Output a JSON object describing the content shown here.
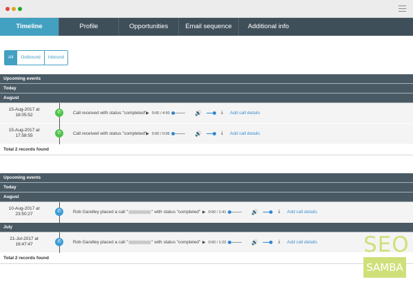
{
  "tabs": [
    "Timeline",
    "Profile",
    "Opportunities",
    "Email sequence",
    "Additional info"
  ],
  "filters": [
    "All",
    "Outbound",
    "Inbound"
  ],
  "sections": [
    {
      "upcoming": "Upcoming events",
      "today": "Today",
      "group1": "August",
      "rows": [
        {
          "date": "15-Aug-2017 at",
          "time": "18:05:52",
          "desc": "Call received with status \"completed\"",
          "player_time": "0:00 / 4:50",
          "add": "Add call details"
        },
        {
          "date": "15-Aug-2017 at",
          "time": "17:58:55",
          "desc": "Call received with status \"completed\"",
          "player_time": "0:00 / 0:06",
          "add": "Add call details"
        }
      ],
      "total": "Total 2 records found"
    },
    {
      "upcoming": "Upcoming events",
      "today": "Today",
      "group1": "August",
      "group2": "July",
      "rows": [
        {
          "date": "10-Aug-2017 at",
          "time": "23:50:27",
          "desc_a": "Rob Gandley placed a call \"",
          "desc_b": "\" with status \"completed\"",
          "player_time": "0:00 / 1:41",
          "add": "Add call details"
        },
        {
          "date": "21-Jul-2017 at",
          "time": "16:47:47",
          "desc_a": "Rob Gandley placed a call \"",
          "desc_b": "\" with status \"completed\"",
          "player_time": "0:00 / 1:22",
          "add": "Add call details"
        }
      ],
      "total": "Total 2 records found"
    }
  ],
  "watermark": {
    "seo": "SEO",
    "samba": "SAMBA"
  }
}
